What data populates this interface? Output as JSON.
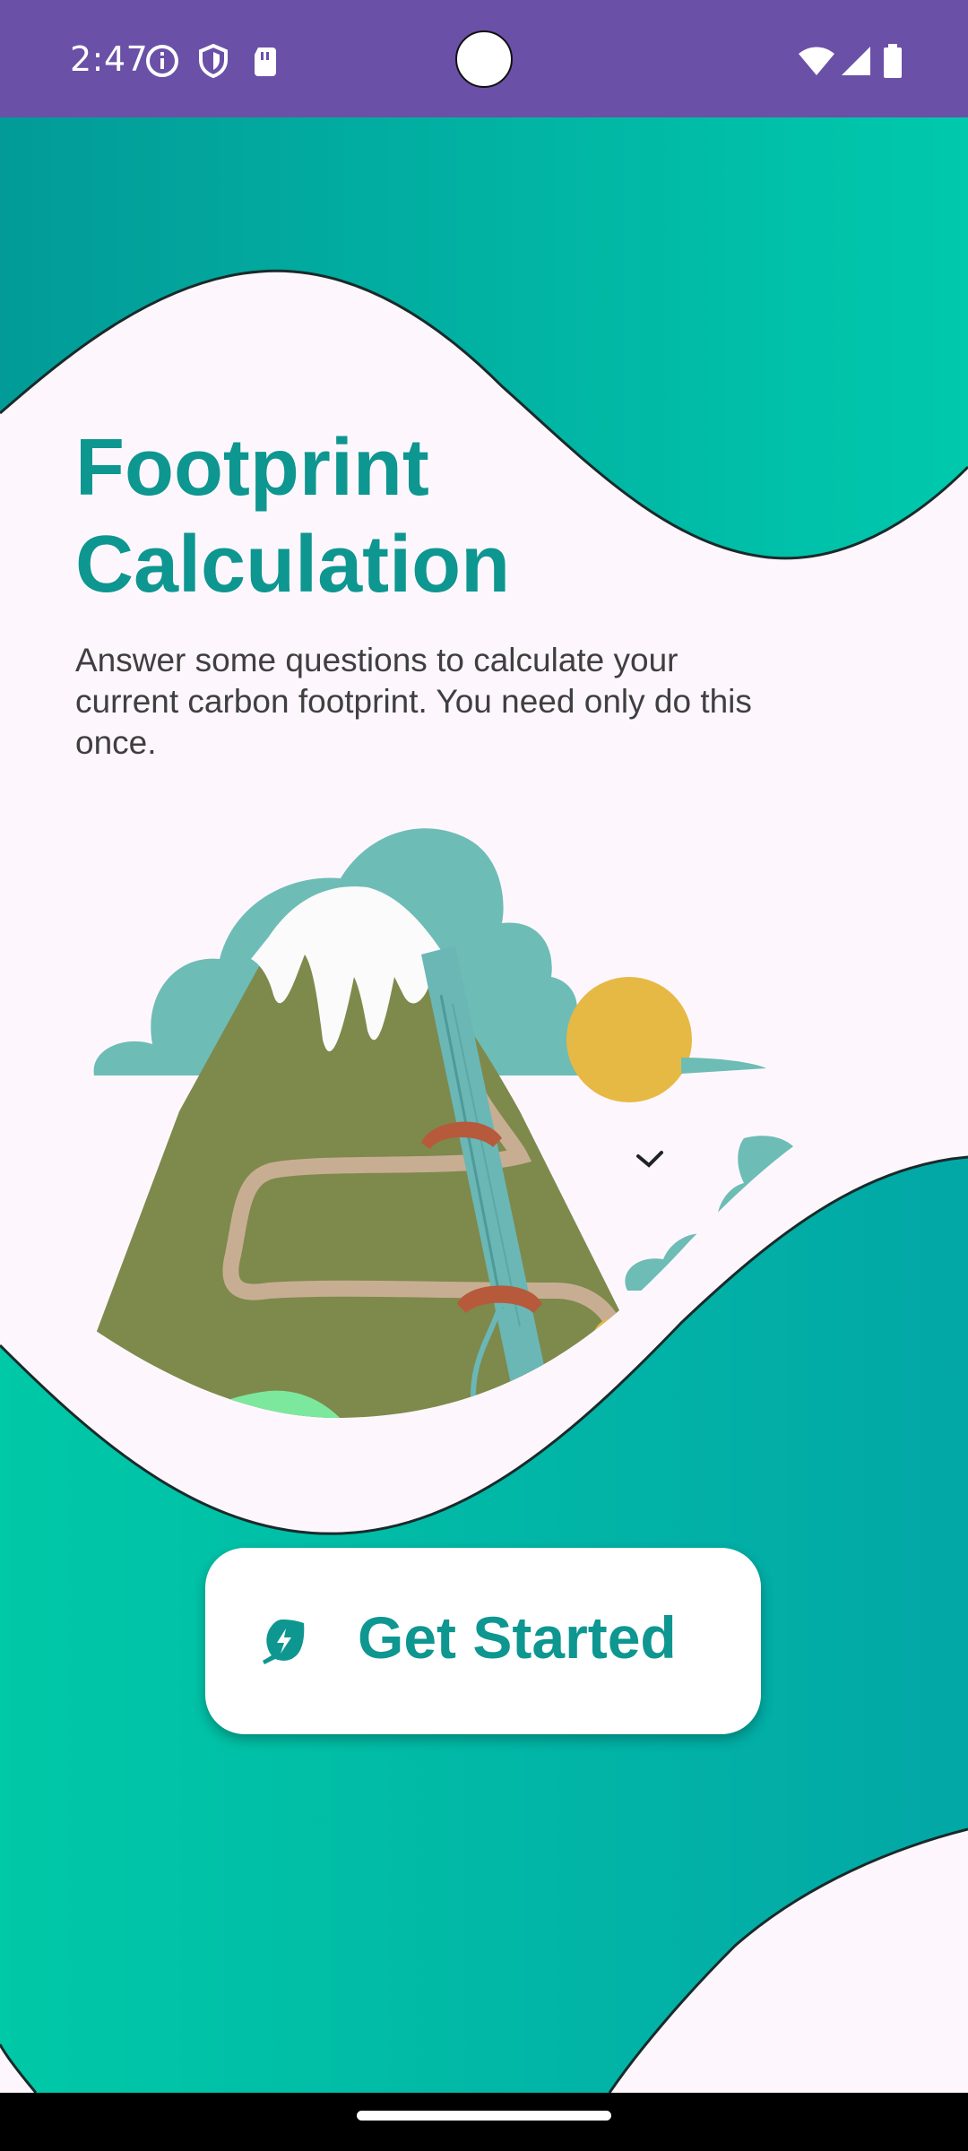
{
  "status_bar": {
    "time": "2:47",
    "icons": [
      "info-icon",
      "shield-icon",
      "sim-card-icon",
      "wifi-icon",
      "signal-icon",
      "battery-icon"
    ]
  },
  "onboarding": {
    "title": "Footprint Calculation",
    "description": "Answer some questions to calculate your current carbon footprint. You need only do this once.",
    "illustration": "mountain-illustration",
    "primary_button": {
      "label": "Get Started",
      "icon": "eco-bolt-icon"
    }
  },
  "colors": {
    "accent": "#0e9690",
    "teal_light": "#00c9a7",
    "teal_dark": "#009c97",
    "status_bar": "#6a50a7",
    "background": "#fdf7fd"
  }
}
